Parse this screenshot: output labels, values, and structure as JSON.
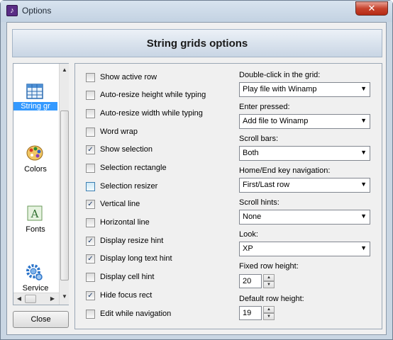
{
  "window": {
    "title": "Options",
    "close_glyph": "✕",
    "app_icon": "music-note-icon"
  },
  "header": {
    "title": "String grids options"
  },
  "sidebar": {
    "items": [
      {
        "label": "String gr",
        "icon": "grid-icon",
        "selected": true
      },
      {
        "label": "Colors",
        "icon": "palette-icon",
        "selected": false
      },
      {
        "label": "Fonts",
        "icon": "font-icon",
        "selected": false
      },
      {
        "label": "Service",
        "icon": "gears-icon",
        "selected": false
      }
    ]
  },
  "close_button": {
    "label": "Close"
  },
  "options": [
    {
      "label": "Show active row",
      "checked": false
    },
    {
      "label": "Auto-resize height while typing",
      "checked": false
    },
    {
      "label": "Auto-resize width while typing",
      "checked": false
    },
    {
      "label": "Word wrap",
      "checked": false
    },
    {
      "label": "Show selection",
      "checked": true
    },
    {
      "label": "Selection rectangle",
      "checked": false
    },
    {
      "label": "Selection resizer",
      "checked": false
    },
    {
      "label": "Vertical line",
      "checked": true
    },
    {
      "label": "Horizontal line",
      "checked": false
    },
    {
      "label": "Display resize hint",
      "checked": true
    },
    {
      "label": "Display long text hint",
      "checked": true
    },
    {
      "label": "Display cell hint",
      "checked": false
    },
    {
      "label": "Hide focus rect",
      "checked": true
    },
    {
      "label": "Edit while navigation",
      "checked": false
    }
  ],
  "settings": {
    "double_click": {
      "label": "Double-click in the grid:",
      "value": "Play file with Winamp"
    },
    "enter_pressed": {
      "label": "Enter pressed:",
      "value": "Add file to Winamp"
    },
    "scroll_bars": {
      "label": "Scroll bars:",
      "value": "Both"
    },
    "home_end": {
      "label": "Home/End key navigation:",
      "value": "First/Last row"
    },
    "scroll_hints": {
      "label": "Scroll hints:",
      "value": "None"
    },
    "look": {
      "label": "Look:",
      "value": "XP"
    },
    "fixed_row_height": {
      "label": "Fixed row height:",
      "value": "20"
    },
    "default_row_height": {
      "label": "Default row height:",
      "value": "19"
    }
  },
  "colors": {
    "title_bar": "#c9d6e3",
    "selection": "#3399ff",
    "close_button": "#c7432d"
  }
}
